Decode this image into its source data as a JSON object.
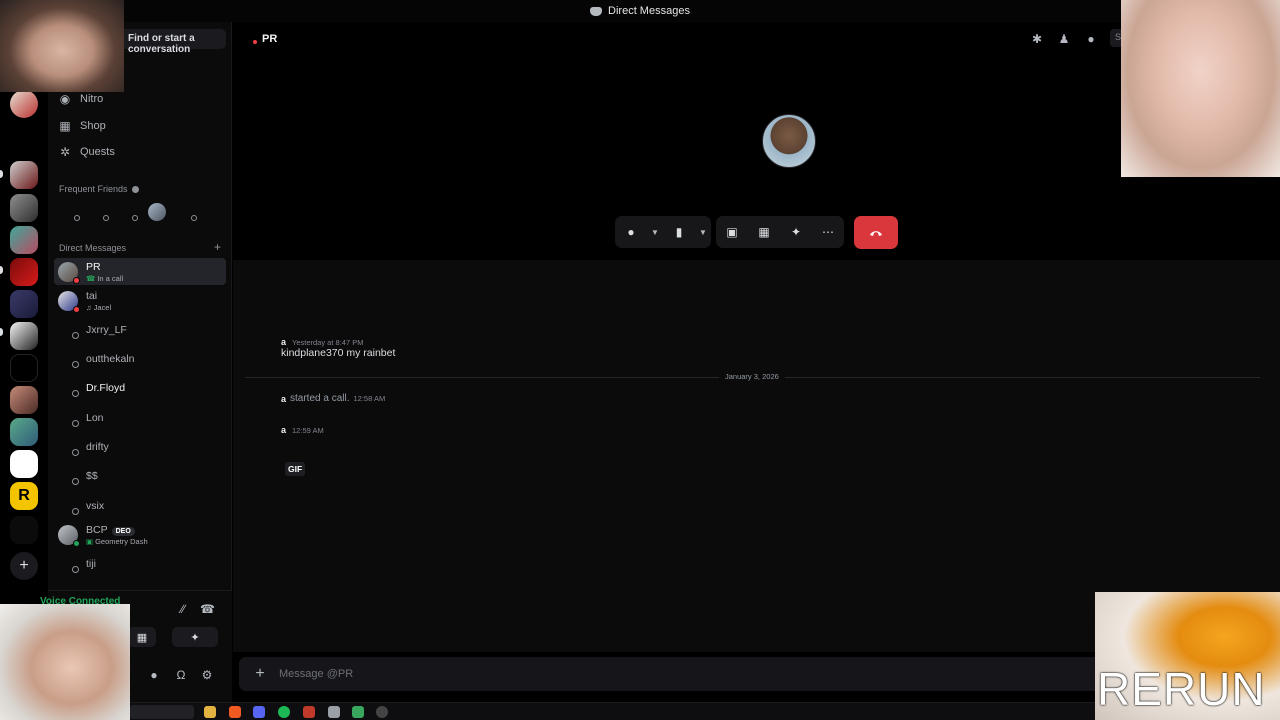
{
  "window": {
    "title": "Direct Messages"
  },
  "sidebar": {
    "find_button_label": "Find or start a conversation",
    "nav": [
      {
        "label": "Nitro",
        "icon": "nitro-icon"
      },
      {
        "label": "Shop",
        "icon": "shop-icon"
      },
      {
        "label": "Quests",
        "icon": "quests-icon"
      }
    ],
    "frequent_friends_header": "Frequent Friends",
    "direct_messages_header": "Direct Messages",
    "dms": [
      {
        "name": "PR",
        "sub": "In a call",
        "active": true,
        "status": "dnd"
      },
      {
        "name": "tai",
        "sub": "Jacel",
        "status": "dnd"
      },
      {
        "name": "Jxrry_LF"
      },
      {
        "name": "outthekaln"
      },
      {
        "name": "Dr.Floyd",
        "bright": true
      },
      {
        "name": "Lon"
      },
      {
        "name": "drifty"
      },
      {
        "name": "$$"
      },
      {
        "name": "vsix"
      },
      {
        "name": "BCP",
        "badge": "DEO",
        "sub": "Geometry Dash",
        "status": "online"
      },
      {
        "name": "tiji"
      }
    ],
    "voice_connected": "Voice Connected"
  },
  "header": {
    "channel_name": "PR",
    "search_placeholder": "S"
  },
  "messages": [
    {
      "author": "a",
      "time": "Yesterday at 8:47 PM",
      "text": "kindplane370 my rainbet"
    }
  ],
  "date_divider": "January 3, 2026",
  "system_message": {
    "author": "a",
    "text": "started a call.",
    "time": "12:58 AM"
  },
  "second_message": {
    "author": "a",
    "time": "12:59 AM",
    "attachment": "GIF"
  },
  "composer": {
    "placeholder": "Message @PR"
  },
  "overlays": {
    "stream_text": "RERUN"
  },
  "colors": {
    "accent_red": "#da373c",
    "online_green": "#23a559",
    "dnd_red": "#f23f43"
  }
}
